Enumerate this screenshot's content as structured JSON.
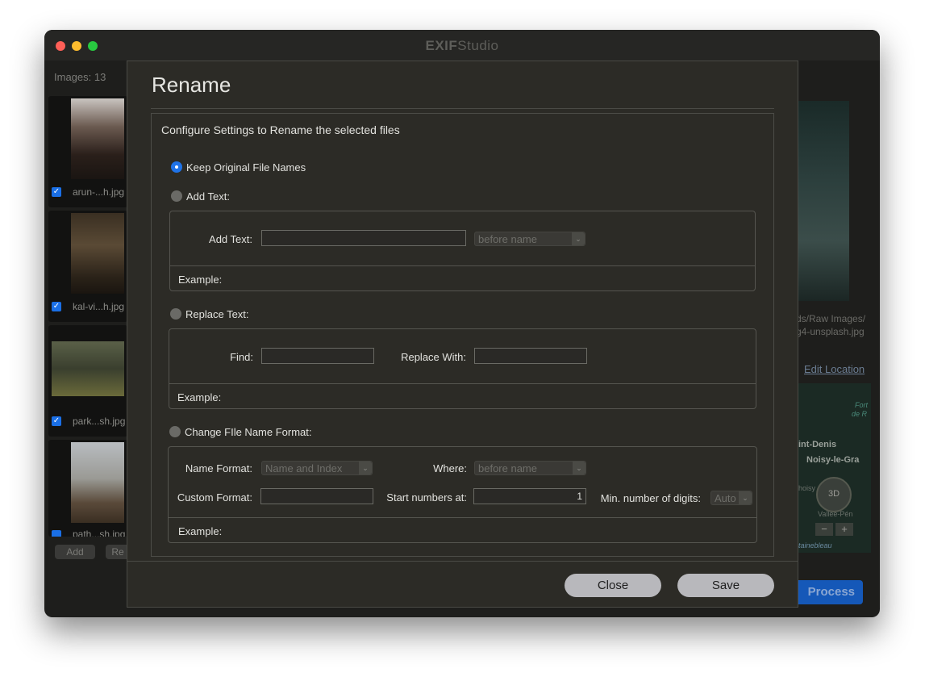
{
  "window": {
    "title_bold": "EXIF",
    "title_light": "Studio",
    "traffic_colors": {
      "close": "#ff5f57",
      "minimize": "#febc2e",
      "zoom": "#28c840"
    }
  },
  "sidebar": {
    "images_count_label": "Images: 13",
    "items": [
      {
        "name": "arun-...h.jpg",
        "checked": "✓"
      },
      {
        "name": "kal-vi...h.jpg",
        "checked": "✓"
      },
      {
        "name": "park...sh.jpg",
        "checked": "✓"
      },
      {
        "name": "path...sh.jpg",
        "checked": "✓"
      }
    ],
    "add_label": "Add",
    "remove_label": "Re"
  },
  "detail": {
    "path_line1": "ds/Raw Images/",
    "path_line2": "g4-unsplash.jpg",
    "edit_location_label": "Edit Location",
    "map_labels": {
      "fort1": "Fort",
      "fort2": "de R",
      "saint_denis": "int-Denis",
      "noisy": "Noisy-le-Gra",
      "choisy": "hoisy",
      "vallee": "Vallée-Pén",
      "fontainebleau": "tainebleau"
    },
    "compass_label": "3D",
    "zoom_minus": "−",
    "zoom_plus": "+",
    "process_label": "Process"
  },
  "dialog": {
    "title": "Rename",
    "subtitle": "Configure Settings to Rename the selected files",
    "keep_original_label": "Keep Original File Names",
    "add_text": {
      "radio_label": "Add Text:",
      "field_label": "Add Text:",
      "value": "",
      "position": "before name",
      "example_label": "Example:"
    },
    "replace_text": {
      "radio_label": "Replace Text:",
      "find_label": "Find:",
      "find_value": "",
      "replace_label": "Replace With:",
      "replace_value": "",
      "example_label": "Example:"
    },
    "format": {
      "radio_label": "Change FIle Name Format:",
      "name_format_label": "Name Format:",
      "name_format_value": "Name and Index",
      "where_label": "Where:",
      "where_value": "before name",
      "custom_format_label": "Custom Format:",
      "custom_format_value": "",
      "start_numbers_label": "Start numbers at:",
      "start_numbers_value": "1",
      "min_digits_label": "Min. number of digits:",
      "min_digits_value": "Auto",
      "example_label": "Example:"
    },
    "close_label": "Close",
    "save_label": "Save"
  }
}
